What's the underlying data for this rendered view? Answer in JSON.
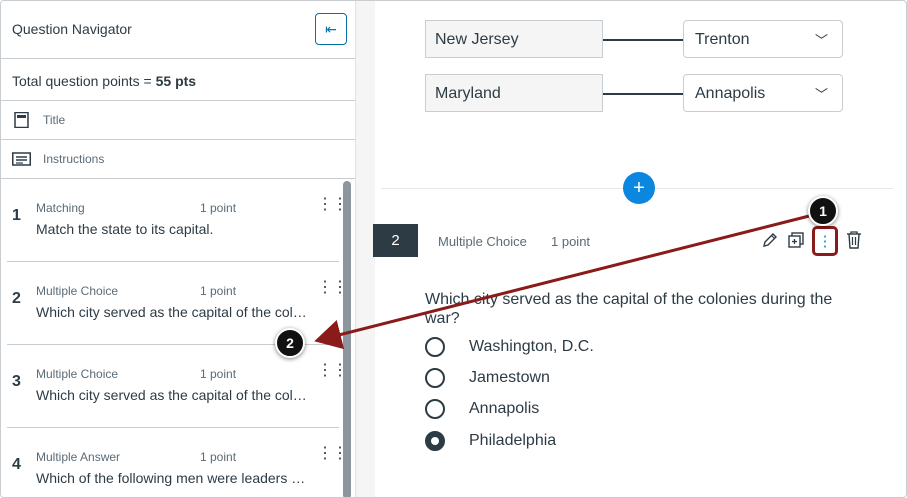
{
  "navigator": {
    "title": "Question Navigator",
    "collapse_icon": "⇤",
    "total_prefix": "Total question points = ",
    "total_value": "55 pts",
    "title_row": "Title",
    "instructions_row": "Instructions",
    "questions": [
      {
        "num": "1",
        "type": "Matching",
        "points": "1 point",
        "text": "Match the state to its capital."
      },
      {
        "num": "2",
        "type": "Multiple Choice",
        "points": "1 point",
        "text": "Which city served as the capital of the colonies during the war?"
      },
      {
        "num": "3",
        "type": "Multiple Choice",
        "points": "1 point",
        "text": "Which city served as the capital of the colonies during the war?"
      },
      {
        "num": "4",
        "type": "Multiple Answer",
        "points": "1 point",
        "text": "Which of the following men were leaders of the colonies?"
      }
    ]
  },
  "matching": [
    {
      "state": "New Jersey",
      "capital": "Trenton"
    },
    {
      "state": "Maryland",
      "capital": "Annapolis"
    }
  ],
  "add_icon": "+",
  "question": {
    "num": "2",
    "type": "Multiple Choice",
    "points": "1 point",
    "prompt": "Which city served as the capital of the colonies during the war?",
    "options": [
      {
        "label": "Washington, D.C.",
        "selected": false
      },
      {
        "label": "Jamestown",
        "selected": false
      },
      {
        "label": "Annapolis",
        "selected": false
      },
      {
        "label": "Philadelphia",
        "selected": true
      }
    ]
  },
  "callouts": {
    "one": "1",
    "two": "2"
  },
  "colors": {
    "accent": "#0b87e0",
    "highlight": "#8b1a1a",
    "dark": "#2d3b45"
  }
}
